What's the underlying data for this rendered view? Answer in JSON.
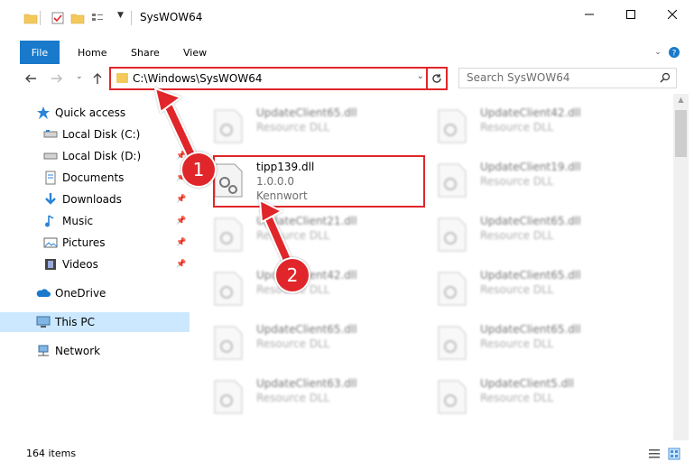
{
  "window": {
    "title": "SysWOW64"
  },
  "ribbon": {
    "tabs": [
      "File",
      "Home",
      "Share",
      "View"
    ]
  },
  "address": {
    "path": "C:\\Windows\\SysWOW64"
  },
  "search": {
    "placeholder": "Search SysWOW64"
  },
  "sidebar": {
    "items": [
      {
        "label": "Quick access",
        "icon": "star-icon"
      },
      {
        "label": "Local Disk (C:)",
        "icon": "drive-icon"
      },
      {
        "label": "Local Disk (D:)",
        "icon": "drive-icon"
      },
      {
        "label": "Documents",
        "icon": "documents-icon"
      },
      {
        "label": "Downloads",
        "icon": "download-icon"
      },
      {
        "label": "Music",
        "icon": "music-icon"
      },
      {
        "label": "Pictures",
        "icon": "pictures-icon"
      },
      {
        "label": "Videos",
        "icon": "videos-icon"
      },
      {
        "label": "OneDrive",
        "icon": "cloud-icon"
      },
      {
        "label": "This PC",
        "icon": "computer-icon"
      },
      {
        "label": "Network",
        "icon": "network-icon"
      }
    ]
  },
  "files": {
    "col1": [
      {
        "name": "UpdateClient65.dll",
        "sub1": "Resource DLL",
        "sub2": ""
      },
      {
        "name": "tipp139.dll",
        "sub1": "1.0.0.0",
        "sub2": "Kennwort"
      },
      {
        "name": "UpdateClient21.dll",
        "sub1": "Resource DLL",
        "sub2": ""
      },
      {
        "name": "UpdateClient42.dll",
        "sub1": "Resource DLL",
        "sub2": ""
      },
      {
        "name": "UpdateClient65.dll",
        "sub1": "Resource DLL",
        "sub2": ""
      },
      {
        "name": "UpdateClient63.dll",
        "sub1": "Resource DLL",
        "sub2": ""
      }
    ],
    "col2": [
      {
        "name": "UpdateClient42.dll",
        "sub1": "Resource DLL"
      },
      {
        "name": "UpdateClient19.dll",
        "sub1": "Resource DLL"
      },
      {
        "name": "UpdateClient65.dll",
        "sub1": "Resource DLL"
      },
      {
        "name": "UpdateClient65.dll",
        "sub1": "Resource DLL"
      },
      {
        "name": "UpdateClient65.dll",
        "sub1": "Resource DLL"
      },
      {
        "name": "UpdateClient5.dll",
        "sub1": "Resource DLL"
      }
    ]
  },
  "status": {
    "item_count": "164 items"
  },
  "annotations": {
    "step1": "1",
    "step2": "2",
    "color": "#e0262a"
  },
  "colors": {
    "accent": "#1979ca",
    "highlight": "#e0262a",
    "selected": "#cce8ff"
  }
}
